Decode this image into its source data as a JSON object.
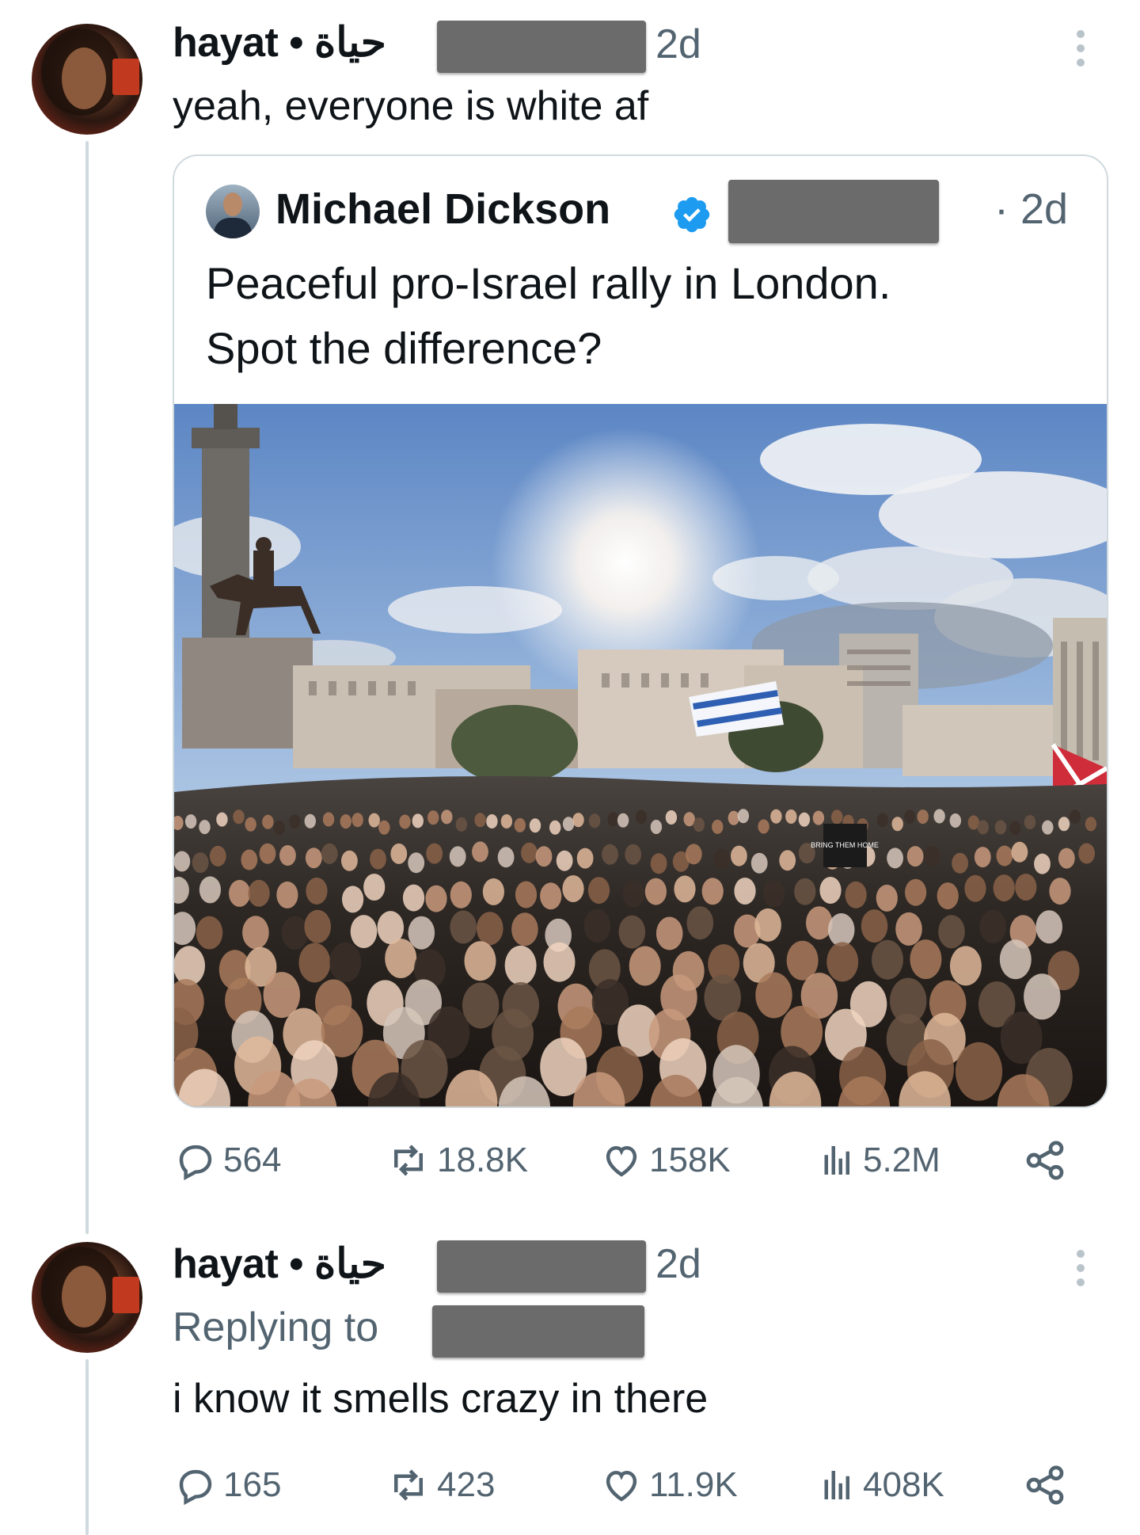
{
  "tweet1": {
    "name": "hayat • حياة",
    "time": "2d",
    "text": "yeah, everyone is white af"
  },
  "quote": {
    "name": "Michael Dickson",
    "time": "· 2d",
    "text_line1": "Peaceful pro-Israel rally in London.",
    "text_line2": "Spot the difference?",
    "sign_text": "BRING THEM HOME"
  },
  "tweet1_actions": {
    "replies": "564",
    "reposts": "18.8K",
    "likes": "158K",
    "views": "5.2M"
  },
  "tweet2": {
    "name": "hayat • حياة",
    "time": "2d",
    "replying_to": "Replying to",
    "text": "i know it smells crazy in there"
  },
  "tweet2_actions": {
    "replies": "165",
    "reposts": "423",
    "likes": "11.9K",
    "views": "408K"
  },
  "icons": [
    "reply-icon",
    "repost-icon",
    "like-icon",
    "views-icon",
    "share-icon",
    "more-icon",
    "verified-icon"
  ],
  "colors": {
    "verified": "#1d9bf0",
    "secondary_text": "#536471",
    "border": "#cfd9de"
  }
}
